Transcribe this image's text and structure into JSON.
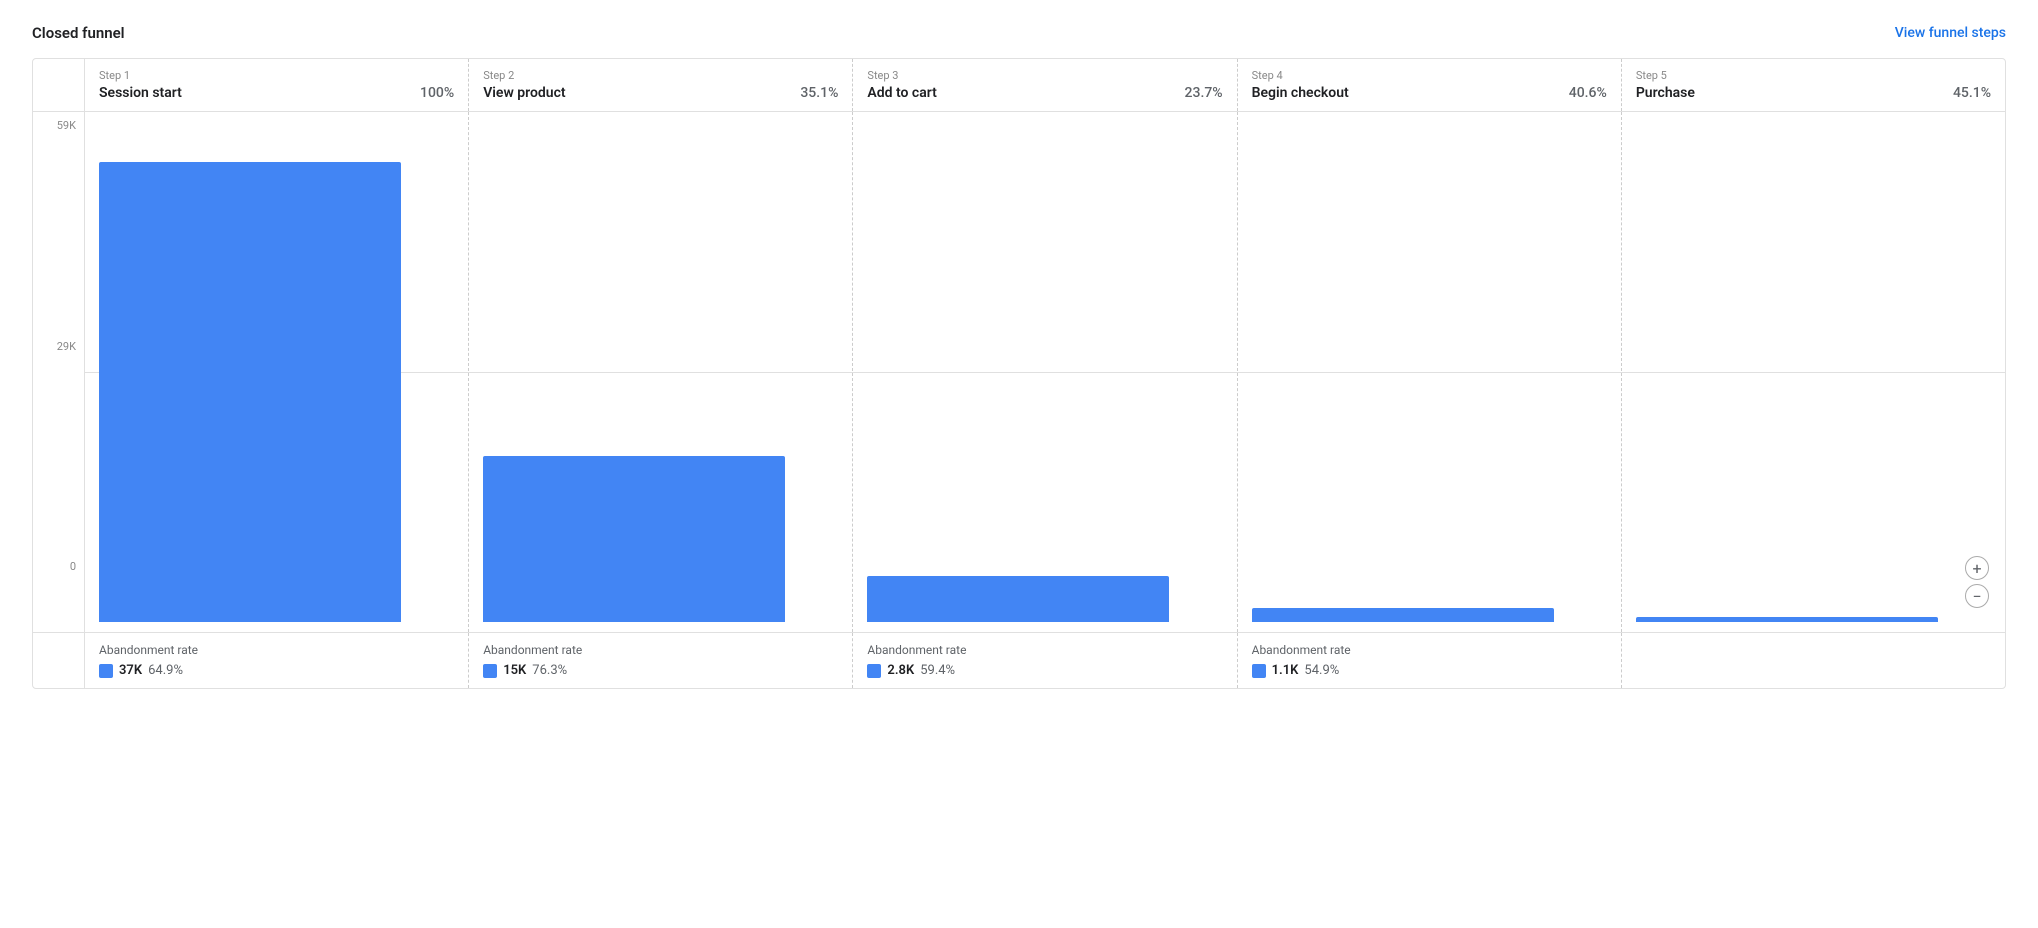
{
  "header": {
    "title": "Closed funnel",
    "view_link": "View funnel steps"
  },
  "steps": [
    {
      "num": "Step 1",
      "name": "Session start",
      "pct": "100%",
      "bar_height_pct": 100,
      "has_abandon": true
    },
    {
      "num": "Step 2",
      "name": "View product",
      "pct": "35.1%",
      "bar_height_pct": 36,
      "has_abandon": true
    },
    {
      "num": "Step 3",
      "name": "Add to cart",
      "pct": "23.7%",
      "bar_height_pct": 10,
      "has_abandon": true
    },
    {
      "num": "Step 4",
      "name": "Begin checkout",
      "pct": "40.6%",
      "bar_height_pct": 3,
      "has_abandon": true
    },
    {
      "num": "Step 5",
      "name": "Purchase",
      "pct": "45.1%",
      "bar_height_pct": 1,
      "has_abandon": false
    }
  ],
  "y_axis": {
    "top": "59K",
    "mid": "29K",
    "bottom": "0"
  },
  "abandonment": [
    {
      "title": "Abandonment rate",
      "value": "37K",
      "pct": "64.9%"
    },
    {
      "title": "Abandonment rate",
      "value": "15K",
      "pct": "76.3%"
    },
    {
      "title": "Abandonment rate",
      "value": "2.8K",
      "pct": "59.4%"
    },
    {
      "title": "Abandonment rate",
      "value": "1.1K",
      "pct": "54.9%"
    },
    {
      "title": "",
      "value": "",
      "pct": ""
    }
  ],
  "zoom": {
    "plus": "+",
    "minus": "−"
  },
  "colors": {
    "bar": "#4285f4",
    "link": "#1a73e8"
  }
}
